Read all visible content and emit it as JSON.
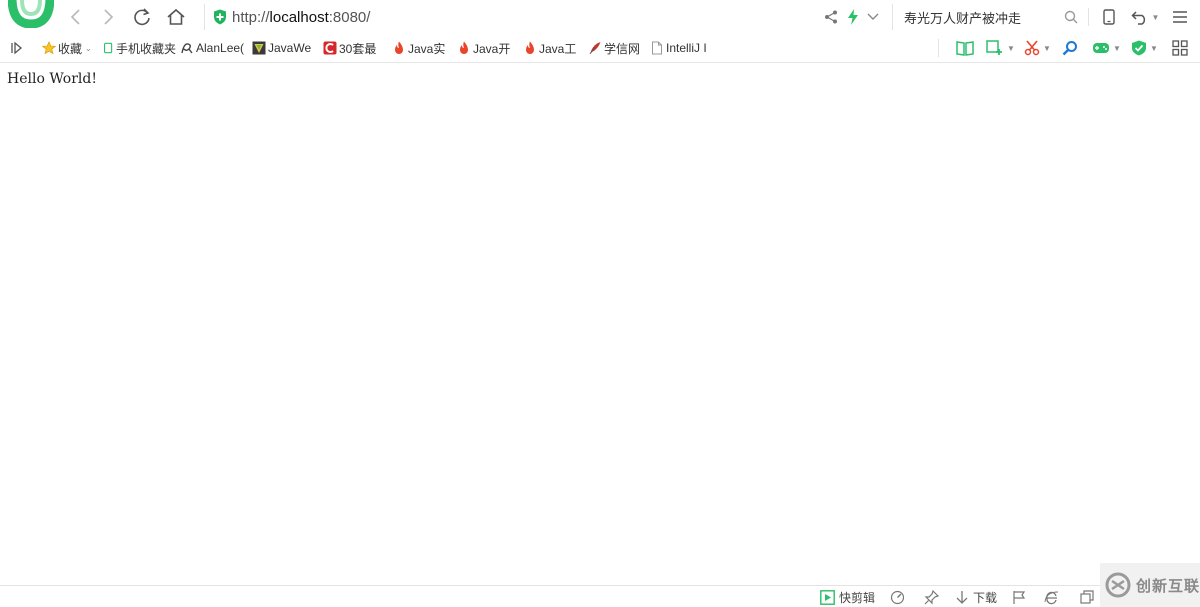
{
  "colors": {
    "accent": "#2bbf6a",
    "shield": "#22b35e",
    "fire": "#e8452c",
    "blue": "#1e78d6"
  },
  "toolbar": {
    "url_prefix": "http://",
    "url_host": "localhost",
    "url_suffix": ":8080/",
    "search_text": "寿光万人财产被冲走"
  },
  "bookmarks": [
    {
      "label": "收藏",
      "icon": "star-icon"
    },
    {
      "label": "手机收藏夹",
      "icon": "phone-icon"
    },
    {
      "label": "AlanLee(",
      "icon": "alan-icon"
    },
    {
      "label": "JavaWe",
      "icon": "javawe-icon"
    },
    {
      "label": "30套最",
      "icon": "c-logo-icon"
    },
    {
      "label": "Java实",
      "icon": "fire-icon"
    },
    {
      "label": "Java开",
      "icon": "fire-icon"
    },
    {
      "label": "Java工",
      "icon": "fire-icon"
    },
    {
      "label": "学信网",
      "icon": "quill-icon"
    },
    {
      "label": "IntelliJ I",
      "icon": "page-icon"
    }
  ],
  "page": {
    "text": "Hello World!"
  },
  "statusbar": {
    "quick_clip": "快剪辑",
    "download": "下载"
  },
  "watermark": {
    "text": "创新互联"
  }
}
